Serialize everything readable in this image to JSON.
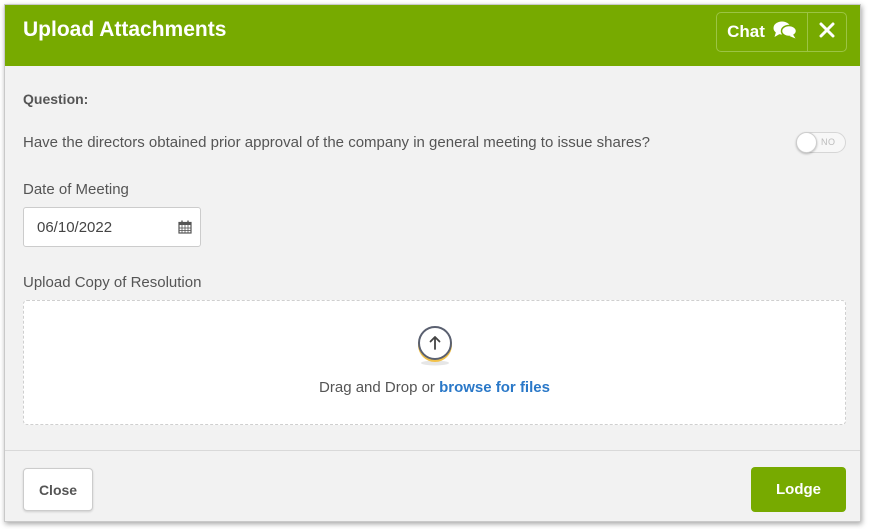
{
  "header": {
    "title": "Upload Attachments",
    "chat_label": "Chat",
    "chat_icon": "chat-bubbles-icon",
    "close_icon": "close-icon"
  },
  "question": {
    "label": "Question:",
    "text": "Have the directors obtained prior approval of the company in general meeting to issue shares?",
    "toggle_state": "NO"
  },
  "date_of_meeting": {
    "label": "Date of Meeting",
    "value": "06/10/2022",
    "icon": "calendar-icon"
  },
  "upload": {
    "label": "Upload Copy of Resolution",
    "drop_text": "Drag and Drop or ",
    "browse_text": "browse for files",
    "icon": "upload-arrow-icon"
  },
  "footer": {
    "close_label": "Close",
    "lodge_label": "Lodge"
  },
  "colors": {
    "brand_green": "#77aa00",
    "link_blue": "#2a78c8"
  }
}
